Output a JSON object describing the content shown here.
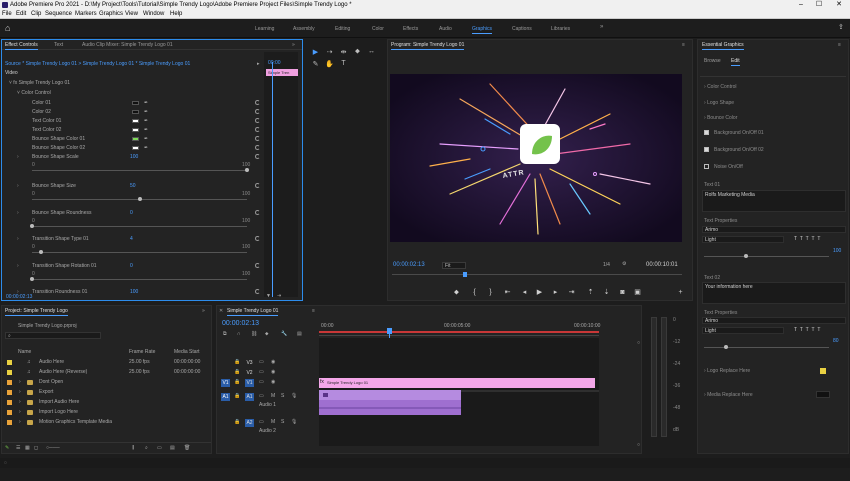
{
  "window": {
    "title": "Adobe Premiere Pro 2021 - D:\\My Project\\Tools\\Tutorial\\Simple Trendy Logo\\Adobe Premiere Project Files\\Simple Trendy Logo *",
    "minimize": "–",
    "maximize": "☐",
    "close": "✕"
  },
  "menu": [
    "File",
    "Edit",
    "Clip",
    "Sequence",
    "Markers",
    "Graphics",
    "View",
    "Window",
    "Help"
  ],
  "workspaces": [
    {
      "label": "Learning",
      "active": false
    },
    {
      "label": "Assembly",
      "active": false
    },
    {
      "label": "Editing",
      "active": false
    },
    {
      "label": "Color",
      "active": false
    },
    {
      "label": "Effects",
      "active": false
    },
    {
      "label": "Audio",
      "active": false
    },
    {
      "label": "Graphics",
      "active": true
    },
    {
      "label": "Captions",
      "active": false
    },
    {
      "label": "Libraries",
      "active": false
    }
  ],
  "effect_controls": {
    "tabs": [
      "Effect Controls",
      "Text",
      "Audio Clip Mixer: Simple Trendy Logo 01"
    ],
    "source": "Source * Simple Trendy Logo 01 > Simple Trendy Logo 01 * Simple Trendy Logo 01",
    "timecode_mini": "00:00",
    "clip_tag": "Simple Tren",
    "video_label": "Video",
    "section": "Simple Trendy Logo 01",
    "group": "Color Control",
    "colors": [
      {
        "label": "Color 01",
        "swatch": "#111111"
      },
      {
        "label": "Color 02",
        "swatch": "#111111"
      },
      {
        "label": "Text Color 01",
        "swatch": "#ffffff"
      },
      {
        "label": "Text Color 02",
        "swatch": "#ffffff"
      },
      {
        "label": "Bounce Shape Color 01",
        "swatch": "#7ed957"
      },
      {
        "label": "Bounce Shape Color 02",
        "swatch": "#ffffff"
      }
    ],
    "params": [
      {
        "label": "Bounce Shape Scale",
        "value": "100",
        "min": "0",
        "max": "100",
        "knob": 1.0
      },
      {
        "label": "Bounce Shape Size",
        "value": "50",
        "min": "0",
        "max": "100",
        "knob": 0.5
      },
      {
        "label": "Bounce Shape Roundness",
        "value": "0",
        "min": "0",
        "max": "100",
        "knob": 0.0
      },
      {
        "label": "Transition Shape Type 01",
        "value": "4",
        "min": "0",
        "max": "100",
        "knob": 0.04
      },
      {
        "label": "Transition Shape Rotation 01",
        "value": "0",
        "min": "0",
        "max": "100",
        "knob": 0.0
      },
      {
        "label": "Transition Roundness 01",
        "value": "100",
        "min": "0",
        "max": "100",
        "knob": 1.0
      }
    ],
    "footer_timecode": "00:00:02:13"
  },
  "program": {
    "tab": "Program: Simple Trendy Logo 01",
    "timecode": "00:00:02:13",
    "fit": "Fit",
    "quality": "1/4",
    "duration": "00:00:10:01",
    "logo_text": "ATTR"
  },
  "essential_graphics": {
    "tab": "Essential Graphics",
    "subtabs": [
      {
        "label": "Browse",
        "active": false
      },
      {
        "label": "Edit",
        "active": true
      }
    ],
    "rows": [
      "Color Control",
      "Logo Shape",
      "Bounce Color"
    ],
    "checks": [
      {
        "label": "Background On/Off 01",
        "checked": true
      },
      {
        "label": "Background On/Off 02",
        "checked": true
      },
      {
        "label": "Noise On/Off",
        "checked": false
      }
    ],
    "text1_label": "Text 01",
    "text1_value": "Rolfs Marketing Media",
    "text_props_label": "Text Properties",
    "font1": "Arimo",
    "style1": "Light",
    "size1": "100",
    "text2_label": "Text 02",
    "text2_value": "Your information here",
    "text_props2_label": "Text Properties",
    "font2": "Arimo",
    "style2": "Light",
    "size2": "80",
    "logo_rows": [
      "Logo Replace Here",
      "Media Replace Here"
    ]
  },
  "project": {
    "tab": "Project: Simple Trendy Logo",
    "file": "Simple Trendy Logo.prproj",
    "columns": [
      "Name",
      "Frame Rate",
      "Media Start"
    ],
    "items": [
      {
        "name": "Audio Here",
        "rate": "25.00 fps",
        "start": "00:00:00:00",
        "color": "#e9d142",
        "type": "audio"
      },
      {
        "name": "Audio Here (Reverse)",
        "rate": "25.00 fps",
        "start": "00:00:00:00",
        "color": "#e9d142",
        "type": "audio"
      },
      {
        "name": "Dont Open",
        "rate": "",
        "start": "",
        "color": "#e9a33a",
        "type": "folder"
      },
      {
        "name": "Export",
        "rate": "",
        "start": "",
        "color": "#e9a33a",
        "type": "folder"
      },
      {
        "name": "Import Audio Here",
        "rate": "",
        "start": "",
        "color": "#e9a33a",
        "type": "folder"
      },
      {
        "name": "Import Logo Here",
        "rate": "",
        "start": "",
        "color": "#e9a33a",
        "type": "folder"
      },
      {
        "name": "Motion Graphics Template Media",
        "rate": "",
        "start": "",
        "color": "#e9a33a",
        "type": "folder"
      }
    ]
  },
  "timeline": {
    "tab": "Simple Trendy Logo 01",
    "timecode": "00:00:02:13",
    "ruler": [
      "00:00",
      "00:00:05:00",
      "00:00:10:00"
    ],
    "tracks": [
      {
        "id": "V3",
        "label": ""
      },
      {
        "id": "V2",
        "label": ""
      },
      {
        "id": "V1",
        "label": ""
      },
      {
        "id": "A1",
        "label": "Audio 1"
      },
      {
        "id": "A2",
        "label": "Audio 2"
      }
    ],
    "clips": [
      {
        "label": "Simple Trendy Logo 01",
        "color": "#f4a7e9"
      },
      {
        "label": "",
        "color": "#9f6fd0"
      }
    ],
    "meter_db": [
      "0",
      "-12",
      "-24",
      "-36",
      "-48",
      "dB"
    ]
  }
}
